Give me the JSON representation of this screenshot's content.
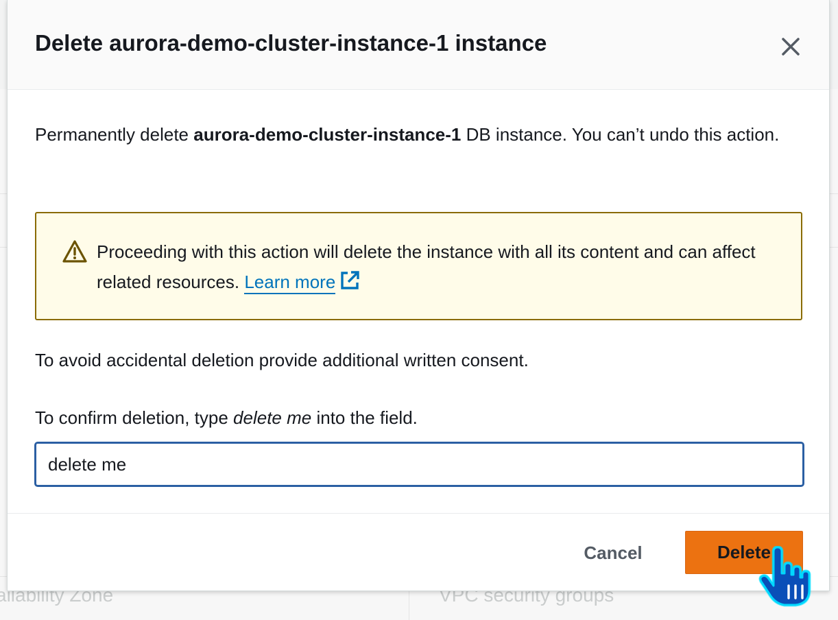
{
  "background": {
    "left_label": "ailability Zone",
    "right_label": "VPC security groups"
  },
  "modal": {
    "title": "Delete aurora-demo-cluster-instance-1 instance",
    "close_icon": "close-icon",
    "description": {
      "prefix": "Permanently delete ",
      "instance_name": "aurora-demo-cluster-instance-1",
      "suffix": " DB instance. You can’t undo this action."
    },
    "alert": {
      "icon": "warning-icon",
      "text": "Proceeding with this action will delete the instance with all its content and can affect related resources. ",
      "link_label": "Learn more",
      "link_icon": "external-link-icon",
      "border_color": "#8a6b05",
      "background_color": "#fffce9"
    },
    "consent_text": "To avoid accidental deletion provide additional written consent.",
    "confirm": {
      "label_prefix": "To confirm deletion, type ",
      "label_phrase": "delete me",
      "label_suffix": " into the field.",
      "input_value": "delete me"
    },
    "footer": {
      "cancel_label": "Cancel",
      "delete_label": "Delete",
      "delete_color": "#ec7211"
    }
  },
  "cursor": "hand-pointer-icon"
}
